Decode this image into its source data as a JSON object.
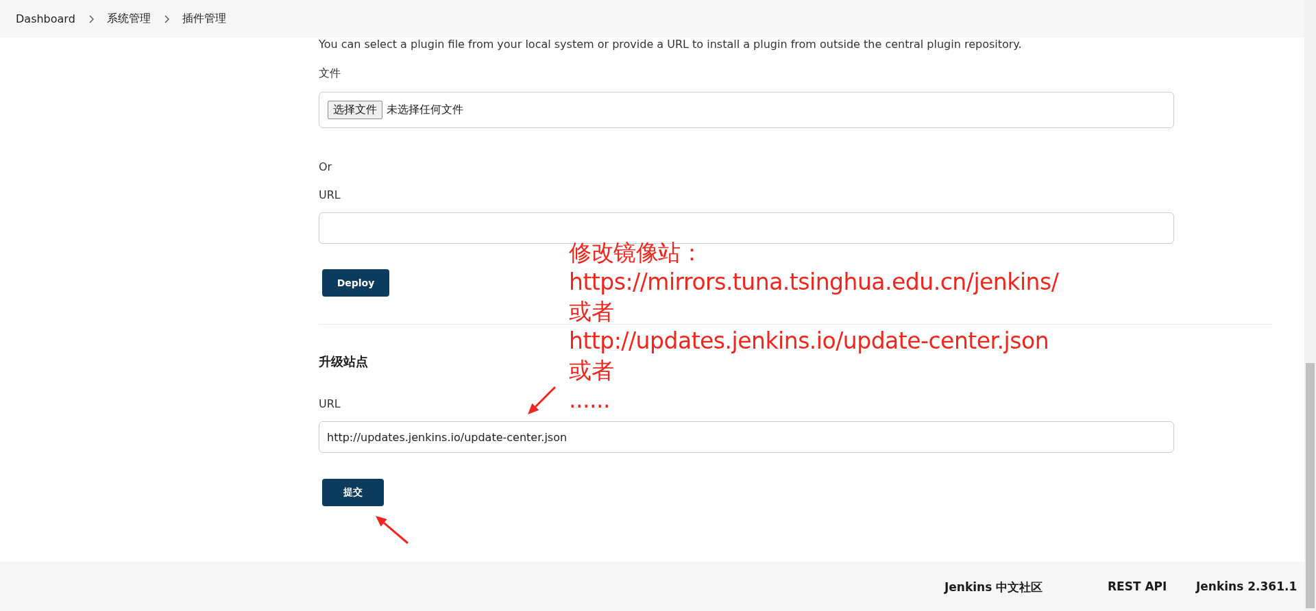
{
  "breadcrumb": [
    "Dashboard",
    "系统管理",
    "插件管理"
  ],
  "deploy_plugin": {
    "description": "You can select a plugin file from your local system or provide a URL to install a plugin from outside the central plugin repository.",
    "file_label": "文件",
    "file_button": "选择文件",
    "file_status": "未选择任何文件",
    "or_label": "Or",
    "url_label": "URL",
    "button": "Deploy"
  },
  "update_site": {
    "heading": "升级站点",
    "url_label": "URL",
    "url_value": "http://updates.jenkins.io/update-center.json",
    "button": "提交"
  },
  "annotation": {
    "lines": [
      "修改镜像站：",
      "https://mirrors.tuna.tsinghua.edu.cn/jenkins/",
      "或者",
      "http://updates.jenkins.io/update-center.json",
      "或者",
      "......"
    ]
  },
  "footer": [
    "Jenkins 中文社区",
    "REST API",
    "Jenkins 2.361.1"
  ]
}
